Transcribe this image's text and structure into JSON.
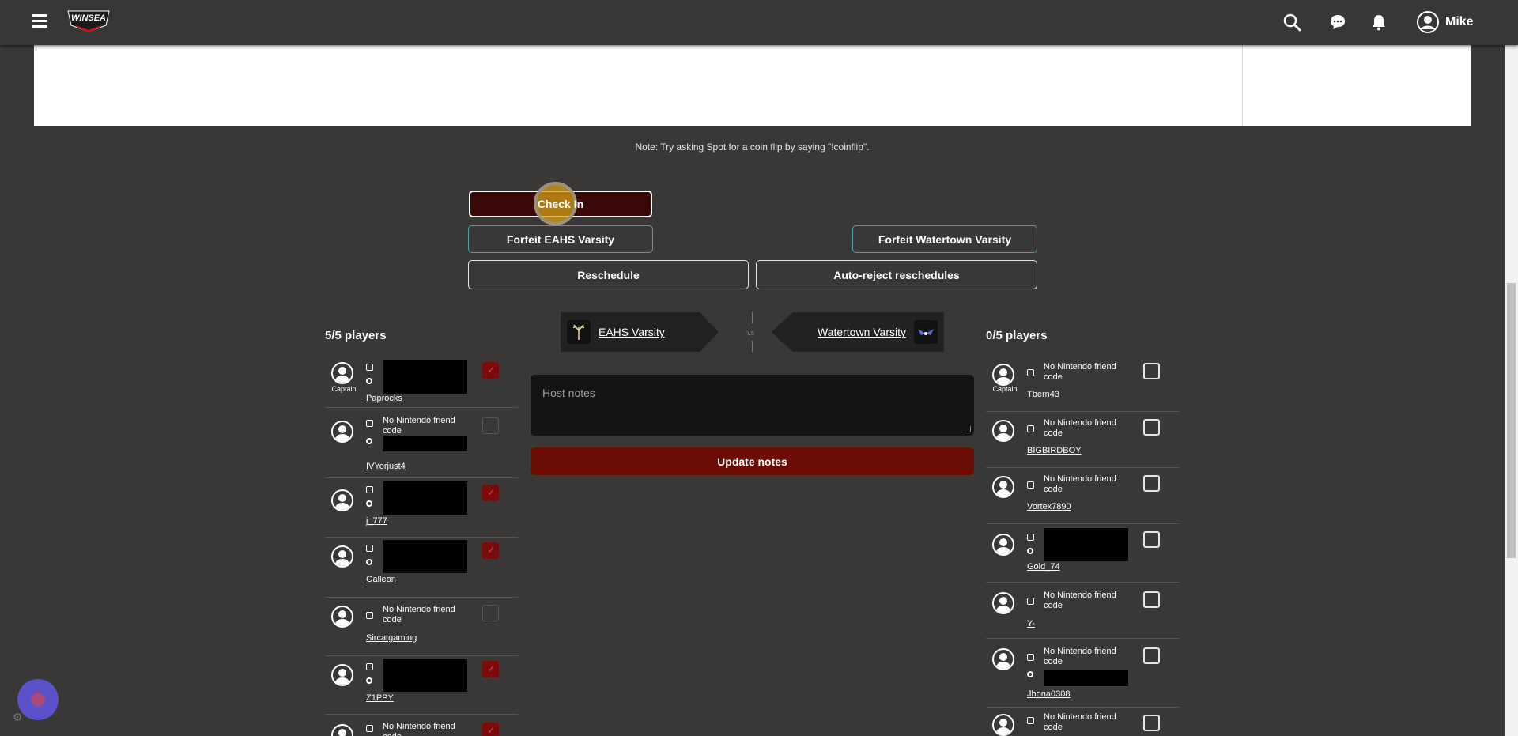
{
  "header": {
    "logo_alt": "WINSEA",
    "user_name": "Mike"
  },
  "note": "Note: Try asking Spot for a coin flip by saying \"!coinflip\".",
  "buttons": {
    "check_in": "Check In",
    "forfeit_left": "Forfeit EAHS Varsity",
    "forfeit_right": "Forfeit Watertown Varsity",
    "reschedule": "Reschedule",
    "auto_reject": "Auto-reject reschedules",
    "update_notes": "Update notes"
  },
  "match": {
    "team_left": "EAHS Varsity",
    "team_right": "Watertown Varsity",
    "vs": "vs"
  },
  "host_notes_placeholder": "Host notes",
  "captain_label": "Captain",
  "no_fc_text": "No Nintendo friend code",
  "left_team": {
    "players_count": "5/5 players",
    "players": [
      {
        "name": "Paprocks",
        "captain": true,
        "no_fc": false,
        "checked": true
      },
      {
        "name": "IVYorjust4",
        "captain": false,
        "no_fc": true,
        "checked": false
      },
      {
        "name": "j_777",
        "captain": false,
        "no_fc": false,
        "checked": true
      },
      {
        "name": "Galleon",
        "captain": false,
        "no_fc": false,
        "checked": true
      },
      {
        "name": "Sircatgaming",
        "captain": false,
        "no_fc": true,
        "checked": false
      },
      {
        "name": "Z1PPY",
        "captain": false,
        "no_fc": false,
        "checked": true
      },
      {
        "name": "",
        "captain": false,
        "no_fc": true,
        "checked": true
      }
    ]
  },
  "right_team": {
    "players_count": "0/5 players",
    "players": [
      {
        "name": "Tbern43",
        "captain": true,
        "no_fc": true,
        "checked": false
      },
      {
        "name": "BIGBIRDBOY",
        "captain": false,
        "no_fc": true,
        "checked": false
      },
      {
        "name": "Vortex7890",
        "captain": false,
        "no_fc": true,
        "checked": false
      },
      {
        "name": "Gold_74",
        "captain": false,
        "no_fc": false,
        "checked": false
      },
      {
        "name": "Y-",
        "captain": false,
        "no_fc": true,
        "checked": false
      },
      {
        "name": "Jhona0308",
        "captain": false,
        "no_fc": true,
        "checked": false
      },
      {
        "name": "",
        "captain": false,
        "no_fc": true,
        "checked": false
      }
    ]
  },
  "colors": {
    "background": "#3a3737",
    "accent_red": "#6b0d04",
    "forfeit_border": "#47a4ad"
  }
}
